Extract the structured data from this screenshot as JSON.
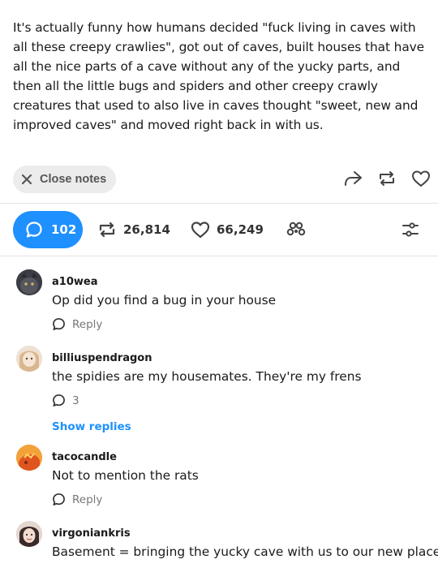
{
  "post": {
    "text": "It's actually funny how humans decided \"fuck living in caves with all these creepy crawlies\", got out of caves, built houses that have all the nice parts of a cave without any of the yucky parts, and then all the little bugs and spiders and other creepy crawly creatures that used to also live in caves thought \"sweet, new and improved caves\" and moved right back in with us."
  },
  "notes_bar": {
    "close_label": "Close notes",
    "icons": [
      "close-icon",
      "share-icon",
      "reblog-icon",
      "heart-icon"
    ]
  },
  "stats": {
    "replies": "102",
    "reblogs": "26,814",
    "likes": "66,249",
    "icons": [
      "speech-bubble-icon",
      "reblog-icon",
      "heart-icon",
      "community-icon",
      "filter-icon"
    ]
  },
  "colors": {
    "accent": "#1e90ff",
    "pill_bg": "#ececec",
    "divider": "#e2e2e2"
  },
  "comments": [
    {
      "username": "a10wea",
      "text": "Op did you find a bug in your house",
      "reply_label": "Reply"
    },
    {
      "username": "billiuspendragon",
      "text": "the spidies are my housemates. They're my frens",
      "reply_count": "3",
      "show_replies": "Show replies"
    },
    {
      "username": "tacocandle",
      "text": "Not to mention the rats",
      "reply_label": "Reply"
    },
    {
      "username": "virgoniankris",
      "text": "Basement = bringing the yucky cave with us to our new place"
    }
  ]
}
